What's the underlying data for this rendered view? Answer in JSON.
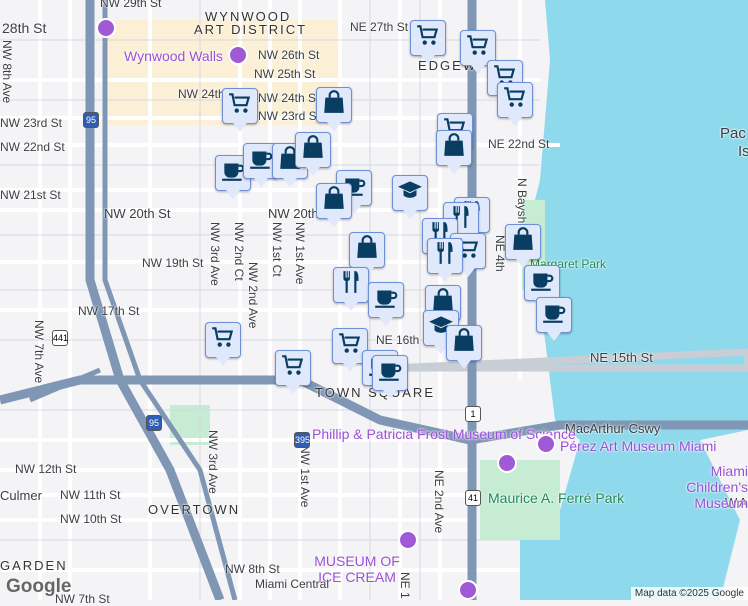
{
  "map": {
    "districts": [
      "WYNWOOD",
      "ART DISTRICT",
      "EDGEW",
      "TOWN SQUARE",
      "OVERTOWN",
      "GARDEN",
      "WA"
    ],
    "streets": [
      "28th St",
      "NW 29th St",
      "NE 27th St",
      "NW 26th St",
      "NW 25th St",
      "NW 24th St",
      "NW 24th St",
      "NW 23rd St",
      "NW 23rd St",
      "NW 22nd St",
      "NE 22nd St",
      "NW 21st St",
      "NW 20th St",
      "NW 20th St",
      "NW 19th St",
      "NW 17th St",
      "NE 16th St",
      "NE 15th St",
      "MacArthur Cswy",
      "NW 12th St",
      "NW 11th St",
      "NW 10th St",
      "NW 8th St",
      "NW 7th St",
      "NW 8th Ave",
      "NW 7th Ave",
      "NW 3rd Ave",
      "NW 2nd Ct",
      "NW 2nd Ave",
      "NW 1st Ct",
      "NW 1st Ave",
      "NE 2nd Ave",
      "NE 1",
      "N Bayshore",
      "NE 4th",
      "NW 3rd Ave",
      "NW 1st Ave"
    ],
    "pois": [
      "Wynwood Walls",
      "Phillip & Patricia Frost Museum of Science",
      "Pérez Art Museum Miami",
      "Miami Children's Museum",
      "MUSEUM OF ICE CREAM",
      "Miami Central"
    ],
    "parks": [
      "Maurice A. Ferré Park",
      "Margaret Park"
    ],
    "misc": [
      "Pac",
      "Is",
      "Culmer"
    ],
    "shields": [
      "95",
      "441",
      "395",
      "1",
      "41",
      "95"
    ],
    "credit": "Map data ©2025 Google",
    "logo": "Google"
  },
  "markers": [
    "cart",
    "bag",
    "coffee",
    "coffee",
    "bag",
    "bag",
    "coffee",
    "bag",
    "school",
    "cart",
    "cart",
    "cart",
    "cart",
    "cart",
    "bag",
    "restaurant",
    "restaurant",
    "restaurant",
    "cart",
    "restaurant",
    "bag",
    "bag",
    "restaurant",
    "coffee",
    "bag",
    "school",
    "bag",
    "coffee",
    "coffee",
    "cart",
    "cart",
    "cart",
    "coffee",
    "coffee"
  ],
  "colors": {
    "water": "#8fd9ec",
    "highway": "#7f97b5",
    "marker_fill": "#dfe9fb",
    "marker_icon": "#0a3d62",
    "poi": "#9b4fd6"
  }
}
